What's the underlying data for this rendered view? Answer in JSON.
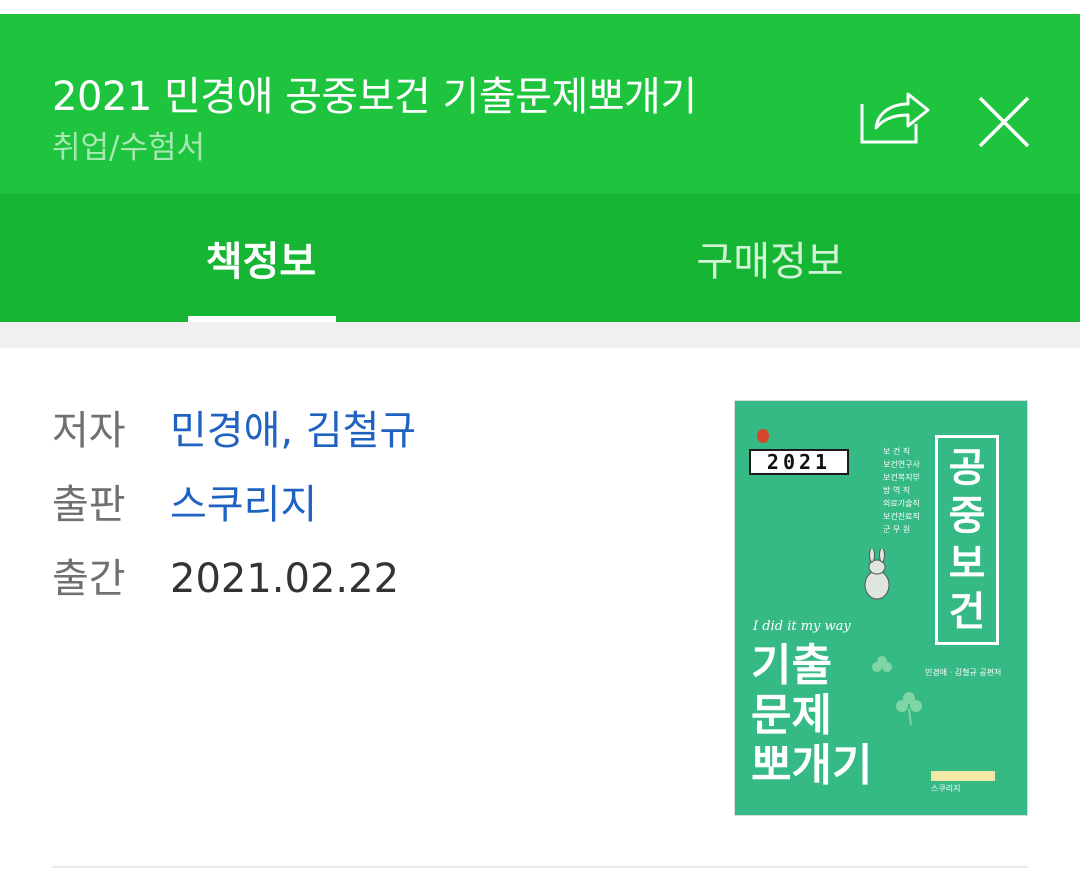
{
  "header": {
    "title": "2021 민경애 공중보건 기출문제뽀개기",
    "category": "취업/수험서",
    "share_icon": "share-icon",
    "close_icon": "close-icon"
  },
  "tabs": [
    {
      "label": "책정보",
      "selected": true
    },
    {
      "label": "구매정보",
      "selected": false
    }
  ],
  "book_info": {
    "author_label": "저자",
    "authors": "민경애, 김철규",
    "publisher_label": "출판",
    "publisher": "스쿠리지",
    "date_label": "출간",
    "date": "2021.02.22"
  },
  "cover": {
    "year": "2021",
    "vertical_title": [
      "공",
      "중",
      "보",
      "건"
    ],
    "jobs": [
      "보 건 직",
      "보건연구사",
      "보건복지부",
      "방 역 직",
      "의료기술직",
      "보건진료직",
      "군 무 원"
    ],
    "tagline": "I did it my way",
    "big_title_lines": [
      "기출",
      "문제",
      "뽀개기"
    ],
    "authors_small": "민경애 · 김철규 공편저",
    "publisher_small": "스쿠리지"
  },
  "colors": {
    "header_green": "#1ec33e",
    "tab_green": "#16b533",
    "link_blue": "#1f62c2",
    "cover_green": "#35b985"
  }
}
